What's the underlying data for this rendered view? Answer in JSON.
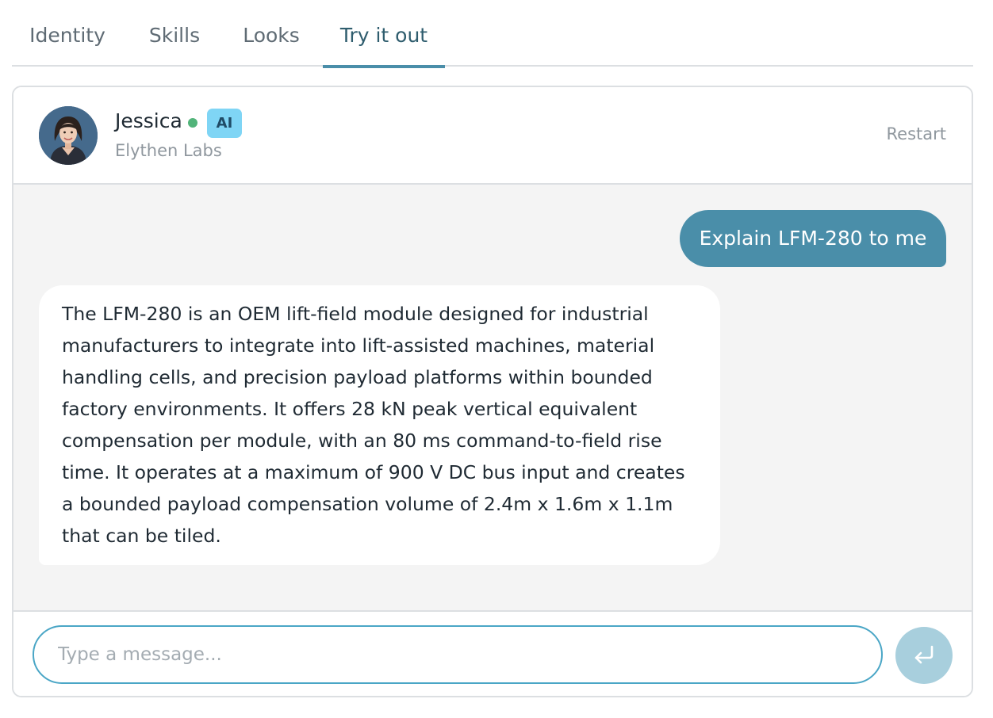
{
  "tabs": [
    {
      "label": "Identity"
    },
    {
      "label": "Skills"
    },
    {
      "label": "Looks"
    },
    {
      "label": "Try it out"
    }
  ],
  "agent": {
    "name": "Jessica",
    "badge": "AI",
    "company": "Elythen Labs",
    "status": "online"
  },
  "header": {
    "restart_label": "Restart"
  },
  "messages": [
    {
      "role": "user",
      "text": "Explain LFM-280 to me"
    },
    {
      "role": "assistant",
      "text": "The LFM-280 is an OEM lift-field module designed for industrial manufacturers to integrate into lift-assisted machines, material handling cells, and precision payload platforms within bounded factory environments. It offers 28 kN peak vertical equivalent compensation per module, with an 80 ms command-to-field rise time. It operates at a maximum of 900 V DC bus input and creates a bounded payload compensation volume of 2.4m x 1.6m x 1.1m that can be tiled."
    }
  ],
  "composer": {
    "placeholder": "Type a message...",
    "value": ""
  },
  "colors": {
    "accent": "#4a8ea9",
    "online": "#52b47a",
    "ai_badge": "#7fd5f5",
    "chat_background": "#f4f4f4"
  }
}
